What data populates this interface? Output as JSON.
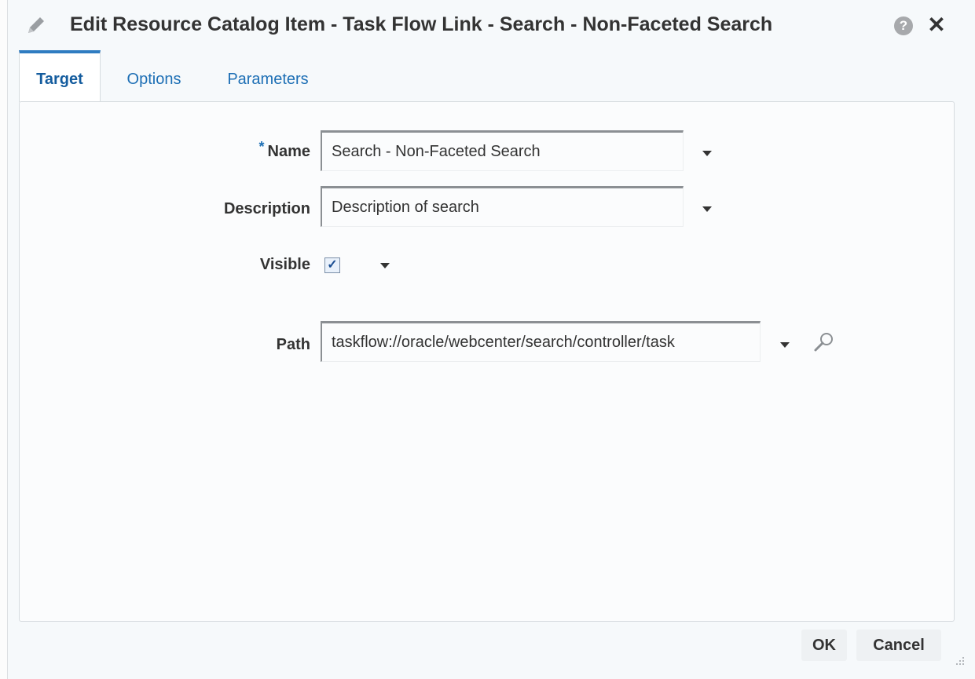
{
  "dialog": {
    "title": "Edit Resource Catalog Item - Task Flow Link - Search - Non-Faceted Search",
    "title_icon": "pencil-icon",
    "help_glyph": "?",
    "close_glyph": "✕"
  },
  "tabs": [
    {
      "label": "Target",
      "active": true
    },
    {
      "label": "Options",
      "active": false
    },
    {
      "label": "Parameters",
      "active": false
    }
  ],
  "form": {
    "name": {
      "required_marker": "*",
      "label": "Name",
      "value": "Search - Non-Faceted Search"
    },
    "description": {
      "label": "Description",
      "value": "Description of search"
    },
    "visible": {
      "label": "Visible",
      "checked": true,
      "check_glyph": "✓"
    },
    "path": {
      "label": "Path",
      "value": "taskflow://oracle/webcenter/search/controller/task"
    }
  },
  "footer": {
    "ok_label": "OK",
    "cancel_label": "Cancel"
  },
  "colors": {
    "accent": "#2f7cc1",
    "tab_text": "#1d6fb5",
    "background": "#f6f9fb"
  }
}
